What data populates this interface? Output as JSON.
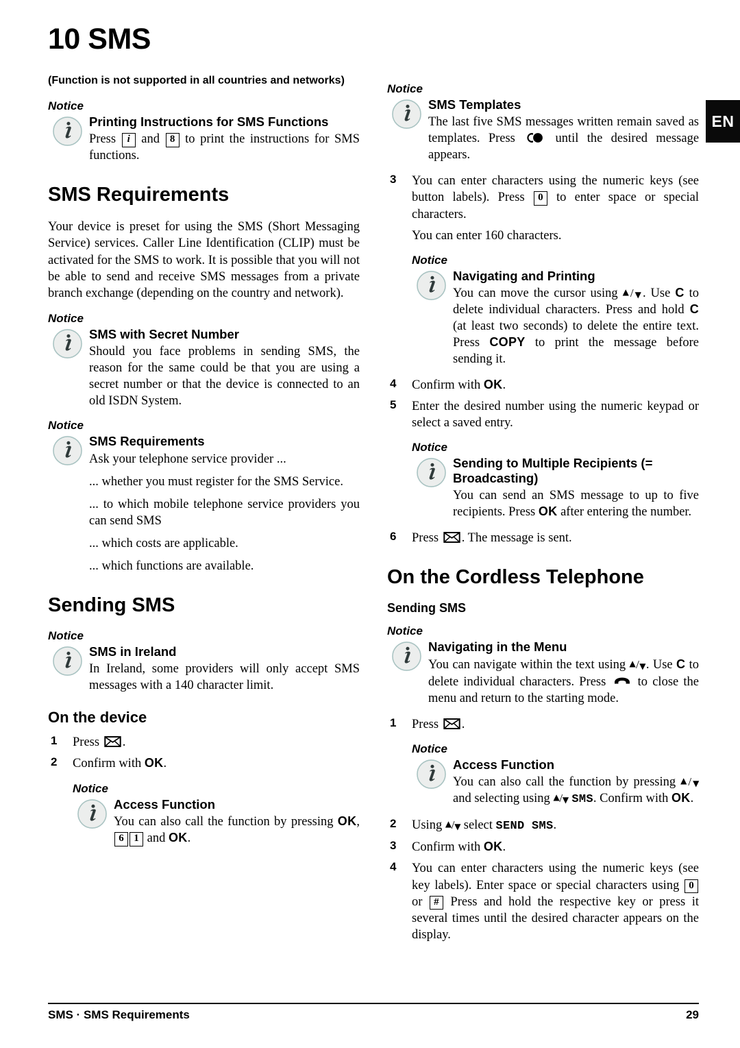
{
  "lang_tab": "EN",
  "chapter_title": "10 SMS",
  "intro_note": "(Function is not supported in all countries and networks)",
  "notice_label": "Notice",
  "icons": {
    "info": "info-icon",
    "envelope": "envelope-icon",
    "redial": "c-dot-redial-icon",
    "hangup": "hangup-handset-icon",
    "arrow_up": "arrow-up-icon",
    "arrow_down": "arrow-down-icon"
  },
  "left_column": {
    "notice_printing": {
      "title": "Printing Instructions for SMS Functions",
      "text_a": "Press",
      "key1": "i",
      "text_b": "and",
      "key2": "8",
      "text_c": "to print the instructions for SMS functions."
    },
    "section_requirements": {
      "heading": "SMS Requirements",
      "paragraph": "Your device is preset for using the SMS (Short Messaging Service) services. Caller Line Identification (CLIP) must be activated for the SMS to work. It is possible that you will not be able to send and receive SMS messages from a private branch exchange (depending on the country and network)."
    },
    "notice_secret": {
      "title": "SMS with Secret Number",
      "text": "Should you face problems in sending SMS, the reason for the same could be that you are using a secret number or that the device is connected to an old ISDN System."
    },
    "notice_requirements": {
      "title": "SMS Requirements",
      "lines": [
        "Ask your telephone service provider ...",
        "... whether you must register for the SMS Service.",
        "... to which mobile telephone service providers you can send SMS",
        "... which costs are applicable.",
        "... which functions are available."
      ]
    },
    "section_sending": {
      "heading": "Sending SMS"
    },
    "notice_ireland": {
      "title": "SMS in Ireland",
      "text": "In Ireland, some providers will only accept SMS messages with a 140 character limit."
    },
    "section_on_device": {
      "heading": "On the device",
      "steps": [
        {
          "num": "1",
          "pre": "Press",
          "icon": "envelope",
          "post": "."
        },
        {
          "num": "2",
          "pre": "Confirm with",
          "button": "OK",
          "post": "."
        }
      ]
    },
    "notice_access_device": {
      "title": "Access Function",
      "text_a": "You can also call the function by pressing",
      "button1": "OK",
      "comma": ",",
      "key1": "6",
      "key2": "1",
      "text_b": "and",
      "button2": "OK",
      "period": "."
    }
  },
  "right_column": {
    "notice_templates": {
      "title": "SMS Templates",
      "text_a": "The last five SMS messages written remain saved as templates. Press",
      "icon": "redial",
      "text_b": "until the desired message appears."
    },
    "step3": {
      "num": "3",
      "text_a": "You can enter characters using the numeric keys (see button labels). Press",
      "key": "0",
      "text_b": "to enter space or special characters."
    },
    "step3_sub": "You can enter 160 characters.",
    "notice_navigating_printing": {
      "title": "Navigating and Printing",
      "text_a": "You can move the cursor using",
      "arrows": "▲/▼",
      "text_b": ". Use",
      "btn_c1": "C",
      "text_c": "to delete individual characters. Press and hold",
      "btn_c2": "C",
      "text_d": "(at least two seconds) to delete the entire text. Press",
      "btn_copy": "COPY",
      "text_e": "to print the message before sending it."
    },
    "step4": {
      "num": "4",
      "pre": "Confirm with",
      "button": "OK",
      "post": "."
    },
    "step5": {
      "num": "5",
      "text": "Enter the desired number using the numeric keypad or select a saved entry."
    },
    "notice_broadcast": {
      "title": "Sending to Multiple Recipients (= Broadcasting)",
      "text_a": "You can send an SMS message to up to five recipients. Press",
      "button": "OK",
      "text_b": "after entering the number."
    },
    "step6": {
      "num": "6",
      "pre": "Press",
      "icon": "envelope",
      "post": ". The message is sent."
    },
    "section_cordless": {
      "heading": "On the Cordless Telephone",
      "subheading": "Sending SMS"
    },
    "notice_navigating_menu": {
      "title": "Navigating in the Menu",
      "text_a": "You can navigate within the text using",
      "arrows": "▲/▼",
      "text_b": ". Use",
      "btn_c": "C",
      "text_c": "to delete individual characters. Press",
      "icon": "hangup",
      "text_d": "to close the menu and return to the starting mode."
    },
    "cordless_step1": {
      "num": "1",
      "pre": "Press",
      "icon": "envelope",
      "post": "."
    },
    "notice_access_cordless": {
      "title": "Access Function",
      "text_a": "You can also call the function by pressing",
      "arrows1": "▲/▼",
      "text_b": "and selecting using",
      "arrows2": "▲/▼",
      "lcd": "SMS",
      "text_c": ". Confirm with",
      "button": "OK",
      "period": "."
    },
    "cordless_step2": {
      "num": "2",
      "pre": "Using",
      "arrows": "▲/▼",
      "mid": "select",
      "lcd": "SEND SMS",
      "post": "."
    },
    "cordless_step3": {
      "num": "3",
      "pre": "Confirm with",
      "button": "OK",
      "post": "."
    },
    "cordless_step4": {
      "num": "4",
      "text_a": "You can enter characters using the numeric keys (see key labels). Enter space or special characters using",
      "key1": "0",
      "text_b": "or",
      "key2": "#",
      "text_c": "Press and hold the respective key or press it several times until the desired character appears on the display."
    }
  },
  "footer": {
    "left": "SMS · SMS Requirements",
    "page": "29"
  }
}
